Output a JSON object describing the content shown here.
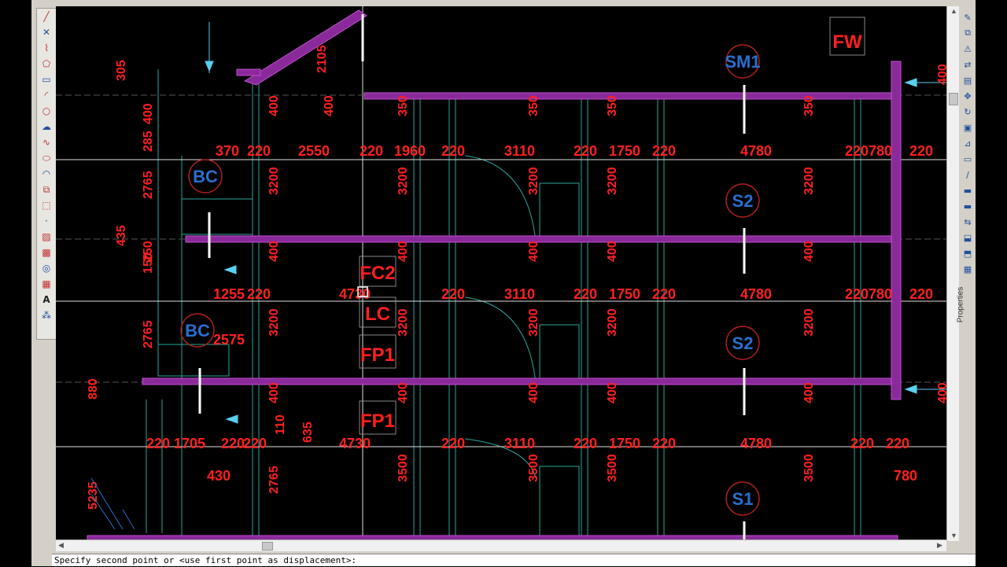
{
  "command_line": {
    "prompt": "Specify second point or <use first point as displacement>:"
  },
  "right_panel": {
    "properties_label": "Properties"
  },
  "left_toolbar": {
    "tools": [
      {
        "name": "line-tool",
        "glyph": "╱"
      },
      {
        "name": "xline-tool",
        "glyph": "✕"
      },
      {
        "name": "polyline-tool",
        "glyph": "⌇"
      },
      {
        "name": "polygon-tool",
        "glyph": "⬠"
      },
      {
        "name": "rectangle-tool",
        "glyph": "▭"
      },
      {
        "name": "arc-tool",
        "glyph": "◜"
      },
      {
        "name": "circle-tool",
        "glyph": "○"
      },
      {
        "name": "revcloud-tool",
        "glyph": "☁"
      },
      {
        "name": "spline-tool",
        "glyph": "∿"
      },
      {
        "name": "ellipse-tool",
        "glyph": "⬭"
      },
      {
        "name": "ellipse-arc-tool",
        "glyph": "◠"
      },
      {
        "name": "insert-block-tool",
        "glyph": "⧉"
      },
      {
        "name": "make-block-tool",
        "glyph": "⬚"
      },
      {
        "name": "point-tool",
        "glyph": "·"
      },
      {
        "name": "hatch-tool",
        "glyph": "▨"
      },
      {
        "name": "gradient-tool",
        "glyph": "▩"
      },
      {
        "name": "region-tool",
        "glyph": "◎"
      },
      {
        "name": "table-tool",
        "glyph": "▦"
      },
      {
        "name": "mtext-tool",
        "glyph": "A"
      },
      {
        "name": "add-selected-tool",
        "glyph": "⁂"
      }
    ]
  },
  "drawing": {
    "level_lines_dims": [
      "370",
      "220",
      "2550",
      "220",
      "1960",
      "220",
      "3110",
      "220",
      "1750",
      "220",
      "4780",
      "220",
      "780",
      "220"
    ],
    "row2_dims": [
      "1255",
      "220",
      "4730",
      "220",
      "3110",
      "220",
      "1750",
      "220",
      "4780",
      "220",
      "780",
      "220"
    ],
    "row3_dims": [
      "220",
      "1705",
      "220",
      "220",
      "4730",
      "220",
      "3110",
      "220",
      "1750",
      "220",
      "4780",
      "220",
      "220"
    ],
    "tags": {
      "sm1": "SM1",
      "s2a": "S2",
      "s2b": "S2",
      "s1": "S1",
      "bc1": "BC",
      "bc2": "BC",
      "fw": "FW",
      "fc2": "FC2",
      "lc": "LC",
      "fp1a": "FP1",
      "fp1b": "FP1"
    },
    "misc": {
      "d2575": "2575",
      "d430": "430",
      "d780": "780",
      "d635": "635",
      "d400": "400",
      "d350": "350",
      "d3200": "3200",
      "d3500": "3500",
      "d2765": "2765",
      "d2105": "2105",
      "d305": "305",
      "d285": "285",
      "d435": "435",
      "d150": "150",
      "d250": "250",
      "d110": "110",
      "d880": "880",
      "d5235": "5235"
    }
  },
  "colors": {
    "linework": "#2aa89a",
    "wall": "#b040c0",
    "dim": "#ff2020",
    "tag": "#2a6fd0",
    "grid": "#e0e0e0"
  }
}
